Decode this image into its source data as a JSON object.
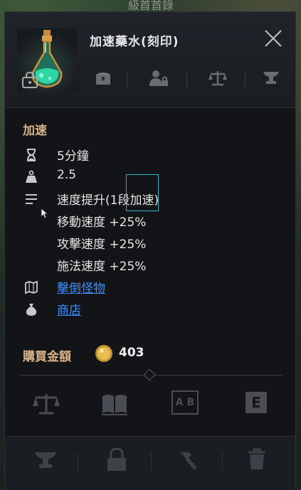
{
  "background_text": "級首首錄",
  "item": {
    "name": "加速藥水(刻印)",
    "category": "加速"
  },
  "stats": {
    "duration": "5分鐘",
    "weight": "2.5",
    "effect_title": "速度提升(1段加速)",
    "move_speed": "移動速度 +25%",
    "attack_speed": "攻擊速度 +25%",
    "cast_speed": "施法速度 +25%",
    "source_link": "擊倒怪物",
    "shop_link": "商店"
  },
  "price": {
    "label": "購買金額",
    "value": "403"
  },
  "action_labels": {
    "ab": "A B",
    "e": "E"
  },
  "colors": {
    "accent_label": "#d7b48a",
    "link": "#3b8fff",
    "highlight": "#2fb8c3"
  }
}
